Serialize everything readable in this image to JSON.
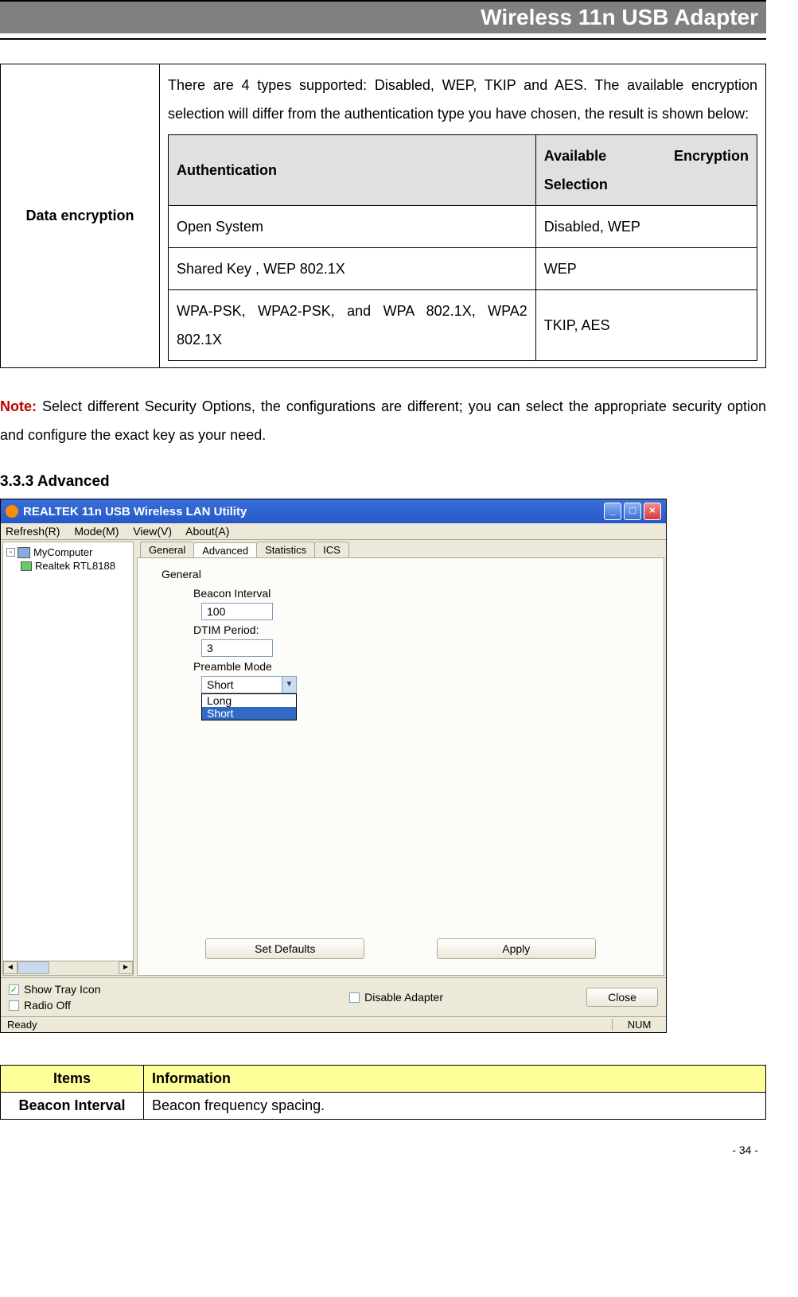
{
  "header": {
    "title": "Wireless 11n USB Adapter"
  },
  "enc_table": {
    "left_label": "Data encryption",
    "intro": "There are 4 types supported: Disabled, WEP, TKIP and AES. The available encryption selection will differ from the authentication type you have chosen, the result is shown below:",
    "inner_header": {
      "auth": "Authentication",
      "enc": "Available Encryption Selection"
    },
    "rows": [
      {
        "auth": "Open System",
        "enc": "Disabled, WEP"
      },
      {
        "auth": "Shared Key , WEP 802.1X",
        "enc": "WEP"
      },
      {
        "auth": "WPA-PSK, WPA2-PSK, and WPA 802.1X, WPA2 802.1X",
        "enc": "TKIP, AES"
      }
    ]
  },
  "note": {
    "label": "Note:",
    "text": " Select different Security Options, the configurations are different; you can select the appropriate security option and configure the exact key as your need."
  },
  "section": {
    "heading": "3.3.3    Advanced"
  },
  "app": {
    "title": "REALTEK 11n USB Wireless LAN Utility",
    "menu": {
      "refresh": "Refresh(R)",
      "mode": "Mode(M)",
      "view": "View(V)",
      "about": "About(A)"
    },
    "tree": {
      "root": "MyComputer",
      "child": "Realtek RTL8188"
    },
    "tabs": {
      "general": "General",
      "advanced": "Advanced",
      "statistics": "Statistics",
      "ics": "ICS"
    },
    "content": {
      "group": "General",
      "beacon_label": "Beacon Interval",
      "beacon_value": "100",
      "dtim_label": "DTIM Period:",
      "dtim_value": "3",
      "preamble_label": "Preamble Mode",
      "preamble_value": "Short",
      "preamble_options": {
        "long": "Long",
        "short": "Short"
      }
    },
    "buttons": {
      "defaults": "Set Defaults",
      "apply": "Apply",
      "close": "Close"
    },
    "checks": {
      "tray": "Show Tray Icon",
      "radio": "Radio Off",
      "disable": "Disable Adapter"
    },
    "status": {
      "ready": "Ready",
      "num": "NUM"
    }
  },
  "items_table": {
    "header": {
      "items": "Items",
      "info": "Information"
    },
    "rows": [
      {
        "item": "Beacon Interval",
        "info": "Beacon frequency spacing."
      }
    ]
  },
  "page_num": "- 34 -"
}
